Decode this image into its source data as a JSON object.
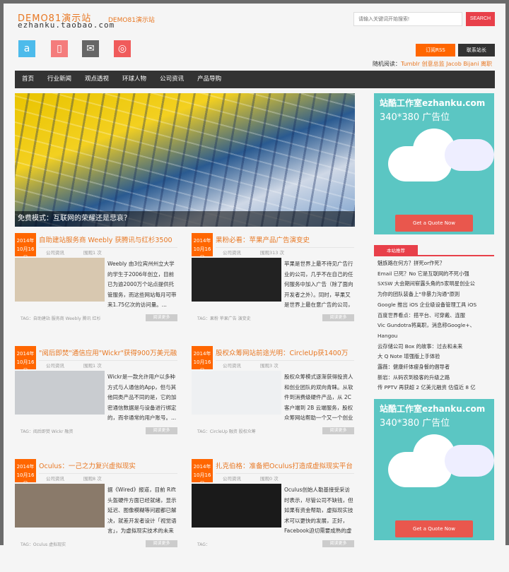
{
  "header": {
    "logo_line1": "DEMO81演示站",
    "logo_line2": "ezhanku.taobao.com",
    "slogan": "DEMO81演示站",
    "search_placeholder": "请输入关键词开始搜索!",
    "search_label": "SEARCH",
    "rss_label": "订阅RSS",
    "contact_label": "联系站长",
    "random_label": "随机阅读：",
    "random_link": "Tumblr 创意总监 Jacob Bijani 离职"
  },
  "social": [
    {
      "icon": "a-icon",
      "color": "#4dbbeb",
      "glyph": "a"
    },
    {
      "icon": "book-icon",
      "color": "#f47c7c",
      "glyph": "▯"
    },
    {
      "icon": "mail-icon",
      "color": "#666666",
      "glyph": "✉"
    },
    {
      "icon": "weibo-icon",
      "color": "#f05b5b",
      "glyph": "◎"
    }
  ],
  "nav": [
    "首页",
    "行业新闻",
    "观点透视",
    "环球人物",
    "公司资讯",
    "产品导购"
  ],
  "hero": {
    "caption": "免费模式：互联网的荣耀还是悲哀？"
  },
  "articles": [
    {
      "year": "2014年",
      "day": "10月16日",
      "title": "自助建站服务商 Weebly 获腾讯与红杉3500",
      "category": "公司资讯",
      "views": "围观1 次",
      "desc": "Weebly 由3位宾州州立大学的学生于2006年创立，目前已为逾2000万个站点提供托管服务，而这些网站每月可带来1.75亿次的访问量。...",
      "tag": "TAG：自助建站 服务商 Weebly 腾讯 红杉",
      "more": "阅读更多",
      "img": "#d8c8b0"
    },
    {
      "year": "2014年",
      "day": "10月16日",
      "title": "果粉必看：苹果产品广告演变史",
      "category": "公司资讯",
      "views": "围观313 次",
      "desc": "苹果是世界上最不待见广告行业的公司，几乎不在自己的任何服务中加入广告（除了面向开发者之外）。同时，苹果又是世界上最在意广告的公司，",
      "tag": "TAG：果粉 苹果广告 演变史",
      "more": "阅读更多",
      "img": "#222222"
    },
    {
      "year": "2014年",
      "day": "10月16日",
      "title": "\"阅后即焚\"通信应用\"Wickr\"获得900万美元融",
      "category": "公司资讯",
      "views": "围观1 次",
      "desc": "Wickr是一款允许用户以多种方式与人通信的App，但与其他同类产品不同的是，它的加密通信数据是与设备进行绑定的，而非通常的用户账号。...",
      "tag": "TAG：阅后即焚 Wickr 融资",
      "more": "阅读更多",
      "img": "#c9ccd0"
    },
    {
      "year": "2014年",
      "day": "10月16日",
      "title": "股权众筹网站前途光明：CircleUp获1400万",
      "category": "公司资讯",
      "views": "围观3 次",
      "desc": "股权众筹模式逐渐获得投资人和创业团队的双向青睐。从软件到消费级硬件产品，从 2C 客户端到 2B 云端服务，股权众筹网站帮助一个又一个创业",
      "tag": "TAG：CircleUp 融资 股权众筹",
      "more": "阅读更多",
      "img": "#eef0f2"
    },
    {
      "year": "2014年",
      "day": "10月16日",
      "title": "Oculus：一己之力复兴虚拟现实",
      "category": "公司资讯",
      "views": "围观8 次",
      "desc": "据《Wired》报道，目前 Rift 头盔硬件方面已经就绪，显示延迟、图像模糊等问题都已解决，就差开发者设计「视觉语言」，为虚拟现实技术的未来",
      "tag": "TAG：Oculus 虚拟现实",
      "more": "阅读更多",
      "img": "#8a7a6a"
    },
    {
      "year": "2014年",
      "day": "10月16日",
      "title": "扎克伯格：准备把Oculus打造成虚拟现实平台",
      "category": "公司资讯",
      "views": "围观0 次",
      "desc": "Oculus创始人勒基接受采访时表示，尽管公司不缺钱，但如果有资金帮助，虚拟现实技术可以更快的发展，正好，Facebook迫切需要成熟的虚",
      "tag": "TAG：",
      "more": "阅读更多",
      "img": "#1a1a1a"
    }
  ],
  "ads": [
    {
      "title": "站酷工作室ezhanku.com",
      "subtitle": "340*380 广告位",
      "button": "Get a Quote Now"
    },
    {
      "title": "站酷工作室ezhanku.com",
      "subtitle": "340*380 广告位",
      "button": "Get a Quote Now"
    }
  ],
  "recommend": {
    "heading": "本站推荐",
    "items": [
      "魅族路在何方？拼死or作死？",
      "Email 已死？No 它是互联网的不死小强",
      "SXSW 大会期间崭露头角的5家明星创业公",
      "为你的团队装备上\"非暴力沟通\"原则",
      "Google 推出 iOS 企业级设备管理工具 iOS",
      "百度世界看点：搭平台、可穿戴、连服",
      "Vic Gundotra将离职，消息称Google+、Hangou",
      "云存储公司 Box 的故事：过去和未来",
      "大 Q Note 增强版上手体验",
      "露薇：健康纤体瘦身餐的倡导者",
      "新岩：从码农到极客的升级之路",
      "传 PPTV 再获超 2 亿美元融资 估值近 8 亿"
    ]
  }
}
